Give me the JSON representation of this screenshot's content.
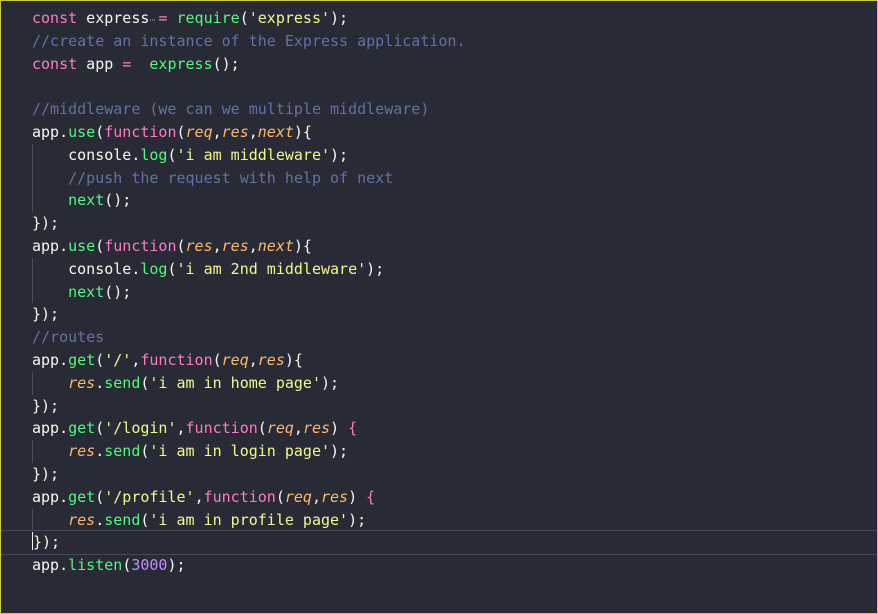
{
  "editor": {
    "lines": [
      {
        "indent": false,
        "tokens": [
          {
            "t": "const",
            "c": "kw"
          },
          {
            "t": " express ",
            "c": "var"
          },
          {
            "t": "=",
            "c": "kw"
          },
          {
            "t": " ",
            "c": "pun"
          },
          {
            "t": "require",
            "c": "fn"
          },
          {
            "t": "(",
            "c": "pun"
          },
          {
            "t": "'express'",
            "c": "str"
          },
          {
            "t": ");",
            "c": "pun"
          }
        ]
      },
      {
        "indent": false,
        "tokens": [
          {
            "t": "//create an instance of the Express application.",
            "c": "com"
          }
        ]
      },
      {
        "indent": false,
        "tokens": [
          {
            "t": "const",
            "c": "kw"
          },
          {
            "t": " app ",
            "c": "var"
          },
          {
            "t": "=",
            "c": "kw"
          },
          {
            "t": "  ",
            "c": "pun"
          },
          {
            "t": "express",
            "c": "fn"
          },
          {
            "t": "();",
            "c": "pun"
          }
        ]
      },
      {
        "indent": false,
        "tokens": []
      },
      {
        "indent": false,
        "tokens": [
          {
            "t": "//middleware (we can we multiple middleware)",
            "c": "com"
          }
        ]
      },
      {
        "indent": false,
        "tokens": [
          {
            "t": "app",
            "c": "var"
          },
          {
            "t": ".",
            "c": "pun"
          },
          {
            "t": "use",
            "c": "fn"
          },
          {
            "t": "(",
            "c": "pun"
          },
          {
            "t": "function",
            "c": "kw"
          },
          {
            "t": "(",
            "c": "pun"
          },
          {
            "t": "req",
            "c": "par"
          },
          {
            "t": ",",
            "c": "pun"
          },
          {
            "t": "res",
            "c": "par"
          },
          {
            "t": ",",
            "c": "pun"
          },
          {
            "t": "next",
            "c": "par"
          },
          {
            "t": "){",
            "c": "pun"
          }
        ]
      },
      {
        "indent": true,
        "tokens": [
          {
            "t": "    console",
            "c": "var"
          },
          {
            "t": ".",
            "c": "pun"
          },
          {
            "t": "log",
            "c": "fn"
          },
          {
            "t": "(",
            "c": "pun"
          },
          {
            "t": "'i am middleware'",
            "c": "str"
          },
          {
            "t": ");",
            "c": "pun"
          }
        ]
      },
      {
        "indent": true,
        "tokens": [
          {
            "t": "    ",
            "c": "pun"
          },
          {
            "t": "//push the request with help of next",
            "c": "com"
          }
        ]
      },
      {
        "indent": true,
        "tokens": [
          {
            "t": "    ",
            "c": "pun"
          },
          {
            "t": "next",
            "c": "fn"
          },
          {
            "t": "();",
            "c": "pun"
          }
        ]
      },
      {
        "indent": false,
        "tokens": [
          {
            "t": "});",
            "c": "pun"
          }
        ]
      },
      {
        "indent": false,
        "tokens": [
          {
            "t": "app",
            "c": "var"
          },
          {
            "t": ".",
            "c": "pun"
          },
          {
            "t": "use",
            "c": "fn"
          },
          {
            "t": "(",
            "c": "pun"
          },
          {
            "t": "function",
            "c": "kw"
          },
          {
            "t": "(",
            "c": "pun"
          },
          {
            "t": "res",
            "c": "par"
          },
          {
            "t": ",",
            "c": "pun"
          },
          {
            "t": "res",
            "c": "par"
          },
          {
            "t": ",",
            "c": "pun"
          },
          {
            "t": "next",
            "c": "par"
          },
          {
            "t": "){",
            "c": "pun"
          }
        ]
      },
      {
        "indent": true,
        "tokens": [
          {
            "t": "    console",
            "c": "var"
          },
          {
            "t": ".",
            "c": "pun"
          },
          {
            "t": "log",
            "c": "fn"
          },
          {
            "t": "(",
            "c": "pun"
          },
          {
            "t": "'i am 2nd middleware'",
            "c": "str"
          },
          {
            "t": ");",
            "c": "pun"
          }
        ]
      },
      {
        "indent": true,
        "tokens": [
          {
            "t": "    ",
            "c": "pun"
          },
          {
            "t": "next",
            "c": "fn"
          },
          {
            "t": "();",
            "c": "pun"
          }
        ]
      },
      {
        "indent": false,
        "tokens": [
          {
            "t": "});",
            "c": "pun"
          }
        ]
      },
      {
        "indent": false,
        "tokens": [
          {
            "t": "//routes",
            "c": "com"
          }
        ]
      },
      {
        "indent": false,
        "tokens": [
          {
            "t": "app",
            "c": "var"
          },
          {
            "t": ".",
            "c": "pun"
          },
          {
            "t": "get",
            "c": "fn"
          },
          {
            "t": "(",
            "c": "pun"
          },
          {
            "t": "'/'",
            "c": "str"
          },
          {
            "t": ",",
            "c": "pun"
          },
          {
            "t": "function",
            "c": "kw"
          },
          {
            "t": "(",
            "c": "pun"
          },
          {
            "t": "req",
            "c": "par"
          },
          {
            "t": ",",
            "c": "pun"
          },
          {
            "t": "res",
            "c": "par"
          },
          {
            "t": "){",
            "c": "pun"
          }
        ]
      },
      {
        "indent": true,
        "tokens": [
          {
            "t": "    ",
            "c": "pun"
          },
          {
            "t": "res",
            "c": "par"
          },
          {
            "t": ".",
            "c": "pun"
          },
          {
            "t": "send",
            "c": "fn"
          },
          {
            "t": "(",
            "c": "pun"
          },
          {
            "t": "'i am in home page'",
            "c": "str"
          },
          {
            "t": ");",
            "c": "pun"
          }
        ]
      },
      {
        "indent": false,
        "tokens": [
          {
            "t": "});",
            "c": "pun"
          }
        ]
      },
      {
        "indent": false,
        "tokens": [
          {
            "t": "app",
            "c": "var"
          },
          {
            "t": ".",
            "c": "pun"
          },
          {
            "t": "get",
            "c": "fn"
          },
          {
            "t": "(",
            "c": "pun"
          },
          {
            "t": "'/login'",
            "c": "str"
          },
          {
            "t": ",",
            "c": "pun"
          },
          {
            "t": "function",
            "c": "kw"
          },
          {
            "t": "(",
            "c": "pun"
          },
          {
            "t": "req",
            "c": "par"
          },
          {
            "t": ",",
            "c": "pun"
          },
          {
            "t": "res",
            "c": "par"
          },
          {
            "t": ") ",
            "c": "pun"
          },
          {
            "t": "{",
            "c": "kw"
          }
        ]
      },
      {
        "indent": true,
        "tokens": [
          {
            "t": "    ",
            "c": "pun"
          },
          {
            "t": "res",
            "c": "par"
          },
          {
            "t": ".",
            "c": "pun"
          },
          {
            "t": "send",
            "c": "fn"
          },
          {
            "t": "(",
            "c": "pun"
          },
          {
            "t": "'i am in login page'",
            "c": "str"
          },
          {
            "t": ");",
            "c": "pun"
          }
        ]
      },
      {
        "indent": false,
        "tokens": [
          {
            "t": "});",
            "c": "pun"
          }
        ]
      },
      {
        "indent": false,
        "tokens": [
          {
            "t": "app",
            "c": "var"
          },
          {
            "t": ".",
            "c": "pun"
          },
          {
            "t": "get",
            "c": "fn"
          },
          {
            "t": "(",
            "c": "pun"
          },
          {
            "t": "'/profile'",
            "c": "str"
          },
          {
            "t": ",",
            "c": "pun"
          },
          {
            "t": "function",
            "c": "kw"
          },
          {
            "t": "(",
            "c": "pun"
          },
          {
            "t": "req",
            "c": "par"
          },
          {
            "t": ",",
            "c": "pun"
          },
          {
            "t": "res",
            "c": "par"
          },
          {
            "t": ") ",
            "c": "pun"
          },
          {
            "t": "{",
            "c": "kw"
          }
        ]
      },
      {
        "indent": true,
        "tokens": [
          {
            "t": "    ",
            "c": "pun"
          },
          {
            "t": "res",
            "c": "par"
          },
          {
            "t": ".",
            "c": "pun"
          },
          {
            "t": "send",
            "c": "fn"
          },
          {
            "t": "(",
            "c": "pun"
          },
          {
            "t": "'i am in profile page'",
            "c": "str"
          },
          {
            "t": ");",
            "c": "pun"
          }
        ]
      },
      {
        "indent": false,
        "current": true,
        "tokens": [
          {
            "t": "});",
            "c": "pun"
          }
        ]
      },
      {
        "indent": false,
        "tokens": [
          {
            "t": "app",
            "c": "var"
          },
          {
            "t": ".",
            "c": "pun"
          },
          {
            "t": "listen",
            "c": "fn"
          },
          {
            "t": "(",
            "c": "pun"
          },
          {
            "t": "3000",
            "c": "num"
          },
          {
            "t": ");",
            "c": "pun"
          }
        ]
      }
    ]
  }
}
